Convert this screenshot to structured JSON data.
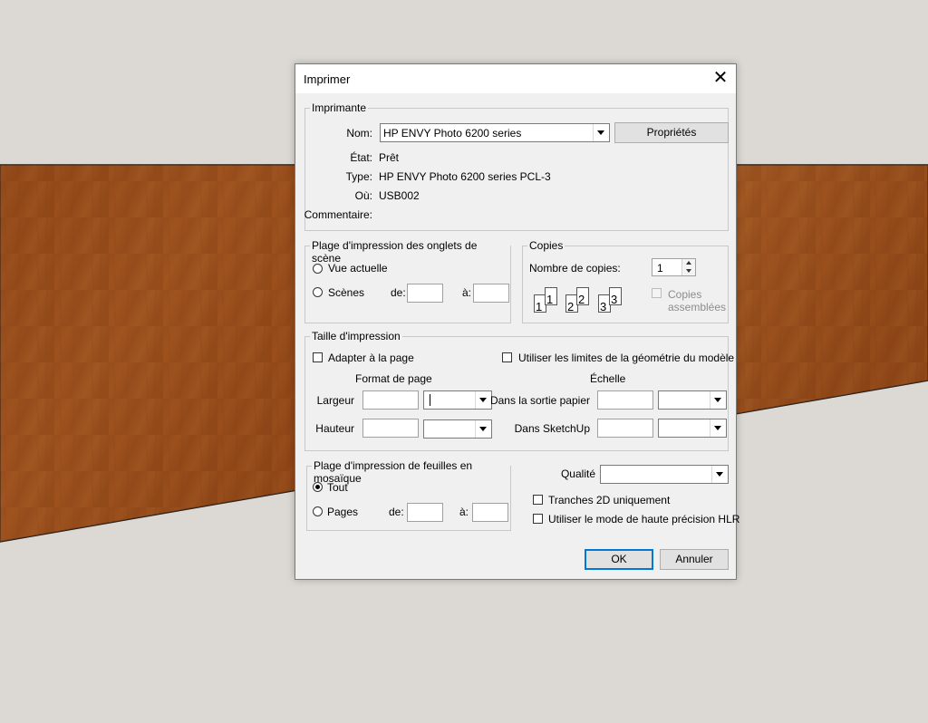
{
  "dialog": {
    "title": "Imprimer",
    "close_glyph": "✕"
  },
  "printer": {
    "legend": "Imprimante",
    "name_label": "Nom:",
    "name_value": "HP ENVY Photo 6200 series",
    "properties_button": "Propriétés",
    "status_label": "État:",
    "status_value": "Prêt",
    "type_label": "Type:",
    "type_value": "HP ENVY Photo 6200 series PCL-3",
    "where_label": "Où:",
    "where_value": "USB002",
    "comment_label": "Commentaire:",
    "comment_value": ""
  },
  "scene_range": {
    "legend": "Plage d'impression des onglets de scène",
    "current_view": "Vue actuelle",
    "scenes": "Scènes",
    "from_label": "de:",
    "to_label": "à:"
  },
  "copies": {
    "legend": "Copies",
    "count_label": "Nombre de copies:",
    "count_value": "1",
    "collate_label_line1": "Copies",
    "collate_label_line2": "assemblées",
    "page_numbers": [
      "1",
      "1",
      "2",
      "2",
      "3",
      "3"
    ]
  },
  "print_size": {
    "legend": "Taille d'impression",
    "fit_page": "Adapter à la page",
    "use_model_extents": "Utiliser les limites de la géométrie du modèle",
    "page_format_header": "Format de page",
    "scale_header": "Échelle",
    "width_label": "Largeur",
    "height_label": "Hauteur",
    "paper_output_label": "Dans la sortie papier",
    "sketchup_label": "Dans SketchUp"
  },
  "tiled_range": {
    "legend": "Plage d'impression de feuilles en mosaïque",
    "all": "Tout",
    "pages": "Pages",
    "from_label": "de:",
    "to_label": "à:"
  },
  "quality": {
    "label": "Qualité",
    "value": "",
    "slices_2d_only": "Tranches 2D uniquement",
    "hlr_mode": "Utiliser le mode de haute précision HLR"
  },
  "buttons": {
    "ok": "OK",
    "cancel": "Annuler"
  },
  "colors": {
    "wood": "#9a4f1e",
    "background": "#dcd9d4",
    "dialog": "#f0f0f0"
  }
}
